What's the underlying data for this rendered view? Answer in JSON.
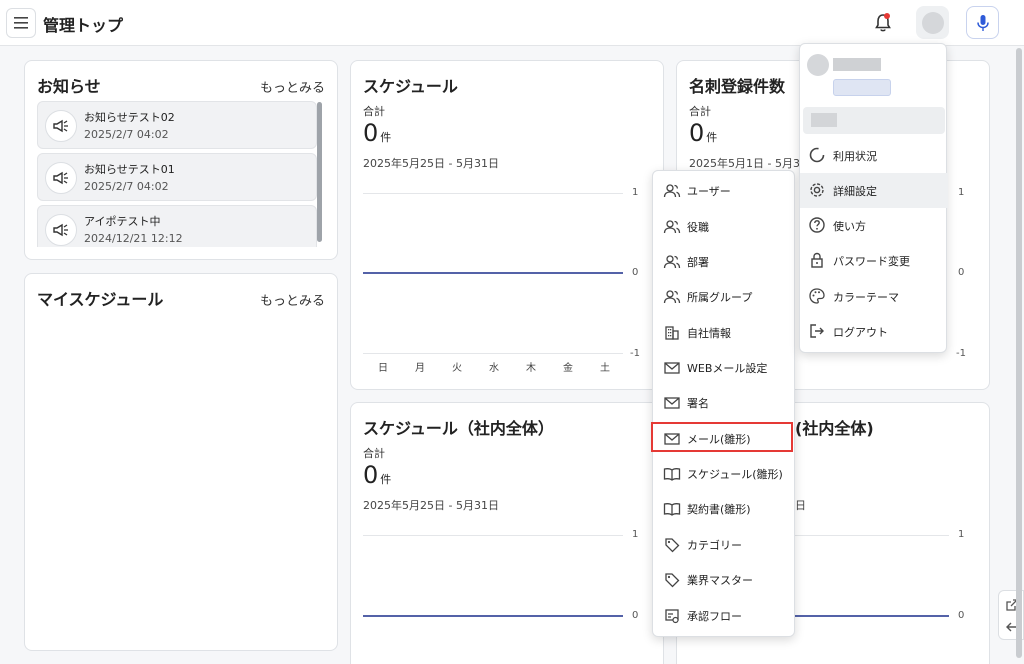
{
  "header": {
    "title": "管理トップ"
  },
  "notices": {
    "title": "お知らせ",
    "more": "もっとみる",
    "items": [
      {
        "title": "お知らせテスト02",
        "date": "2025/2/7 04:02"
      },
      {
        "title": "お知らせテスト01",
        "date": "2025/2/7 04:02"
      },
      {
        "title": "アイポテスト中",
        "date": "2024/12/21 12:12"
      }
    ]
  },
  "my_schedule": {
    "title": "マイスケジュール",
    "more": "もっとみる"
  },
  "schedule": {
    "title": "スケジュール",
    "sum_label": "合計",
    "count": "0",
    "unit": "件",
    "range": "2025年5月25日 - 5月31日",
    "y_ticks": [
      "1",
      "0",
      "-1"
    ],
    "days": [
      "日",
      "月",
      "火",
      "水",
      "木",
      "金",
      "土"
    ]
  },
  "cards": {
    "title": "名刺登録件数",
    "sum_label": "合計",
    "count": "0",
    "unit": "件",
    "range": "2025年5月1日 - 5月31日",
    "y_ticks": [
      "1",
      "0",
      "-1"
    ]
  },
  "schedule_all": {
    "title": "スケジュール（社内全体）",
    "sum_label": "合計",
    "count": "0",
    "unit": "件",
    "range": "2025年5月25日 - 5月31日",
    "y_ticks": [
      "1",
      "0"
    ]
  },
  "right_bottom": {
    "title_partial": "(社内全体)",
    "range_partial": "日",
    "y_ticks": [
      "1",
      "0"
    ]
  },
  "settings_menu": {
    "items": [
      {
        "label": "ユーザー",
        "icon": "users-icon"
      },
      {
        "label": "役職",
        "icon": "users-icon"
      },
      {
        "label": "部署",
        "icon": "users-icon"
      },
      {
        "label": "所属グループ",
        "icon": "users-icon"
      },
      {
        "label": "自社情報",
        "icon": "building-icon"
      },
      {
        "label": "WEBメール設定",
        "icon": "mail-icon"
      },
      {
        "label": "署名",
        "icon": "mail-icon"
      },
      {
        "label": "メール(雛形)",
        "icon": "mail-icon"
      },
      {
        "label": "スケジュール(雛形)",
        "icon": "book-icon"
      },
      {
        "label": "契約書(雛形)",
        "icon": "book-icon"
      },
      {
        "label": "カテゴリー",
        "icon": "tag-icon"
      },
      {
        "label": "業界マスター",
        "icon": "tag-icon"
      },
      {
        "label": "承認フロー",
        "icon": "flow-icon"
      }
    ]
  },
  "account_menu": {
    "items": [
      {
        "label": "利用状況",
        "icon": "usage-icon"
      },
      {
        "label": "詳細設定",
        "icon": "gear-icon"
      },
      {
        "label": "使い方",
        "icon": "help-icon"
      },
      {
        "label": "パスワード変更",
        "icon": "lock-icon"
      },
      {
        "label": "カラーテーマ",
        "icon": "palette-icon"
      },
      {
        "label": "ログアウト",
        "icon": "logout-icon"
      }
    ]
  },
  "colors": {
    "accent": "#5462a8",
    "highlight": "#e53935",
    "mic": "#2f5bd8"
  }
}
